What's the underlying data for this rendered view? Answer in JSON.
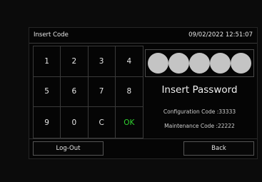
{
  "header": {
    "title": "Insert Code",
    "datetime": "09/02/2022 12:51:07"
  },
  "keypad": {
    "keys": [
      "1",
      "2",
      "3",
      "4",
      "5",
      "6",
      "7",
      "8",
      "9",
      "0",
      "C",
      "OK"
    ]
  },
  "password": {
    "dot_count": 5,
    "prompt": "Insert Password"
  },
  "codes": {
    "configuration": "Configuration Code :33333",
    "maintenance": "Maintenance Code :22222"
  },
  "buttons": {
    "logout": "Log-Out",
    "back": "Back"
  },
  "colors": {
    "ok_key": "#2fd12f",
    "dot": "#c4c4c4",
    "background": "#050505"
  }
}
